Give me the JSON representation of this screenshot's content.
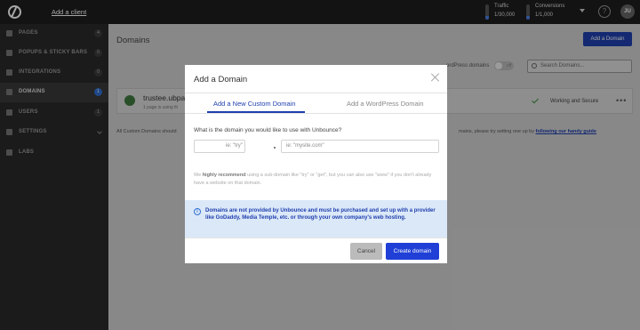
{
  "topbar": {
    "add_client": "Add a client",
    "traffic_label": "Traffic",
    "traffic_value": "1/30,000",
    "conversions_label": "Conversions",
    "conversions_value": "1/1,000",
    "avatar_initials": "JU",
    "help_symbol": "?"
  },
  "sidebar": {
    "items": [
      {
        "label": "PAGES",
        "badge": "4"
      },
      {
        "label": "POPUPS & STICKY BARS",
        "badge": "0"
      },
      {
        "label": "INTEGRATIONS",
        "badge": "0"
      },
      {
        "label": "DOMAINS",
        "badge": "1",
        "active": true
      },
      {
        "label": "USERS",
        "badge": "1"
      },
      {
        "label": "SETTINGS"
      },
      {
        "label": "LABS"
      }
    ]
  },
  "main": {
    "title": "Domains",
    "add_domain_button": "Add a Domain",
    "wp_filter_label": "ordPress domains",
    "toggle_label": "off",
    "search_placeholder": "Search Domains...",
    "domain_card": {
      "domain": "trustee.ubpag",
      "subtext": "1 page is using th",
      "status": "Working and Secure",
      "more": "•••"
    },
    "info_left": "All Custom Domains should",
    "info_right_prefix": "mains, please try setting one up by ",
    "info_right_link": "following our handy guide"
  },
  "modal": {
    "title": "Add a Domain",
    "tabs": [
      "Add a New Custom Domain",
      "Add a WordPress Domain"
    ],
    "question": "What is the domain you would like to use with Unbounce?",
    "subdomain_placeholder": "ie: \"try\" or \"get\"",
    "domain_placeholder": "ie: \"mysite.com\"",
    "recommend_prefix": "We ",
    "recommend_bold": "highly recommend",
    "recommend_rest": " using a sub-domain like \"try\" or \"get\", but you can also use \"www\" if you don't already have a website on that domain.",
    "note": "Domains are not provided by Unbounce and must be purchased and set up with a provider like GoDaddy, Media Temple, etc. or through your own company's web hosting.",
    "cancel_button": "Cancel",
    "create_button": "Create domain"
  },
  "colors": {
    "accent": "#1f3fae",
    "sidebar_bg": "#2a2a2a",
    "topbar_bg": "#1e1e1e",
    "note_bg": "#dbe8f8"
  }
}
